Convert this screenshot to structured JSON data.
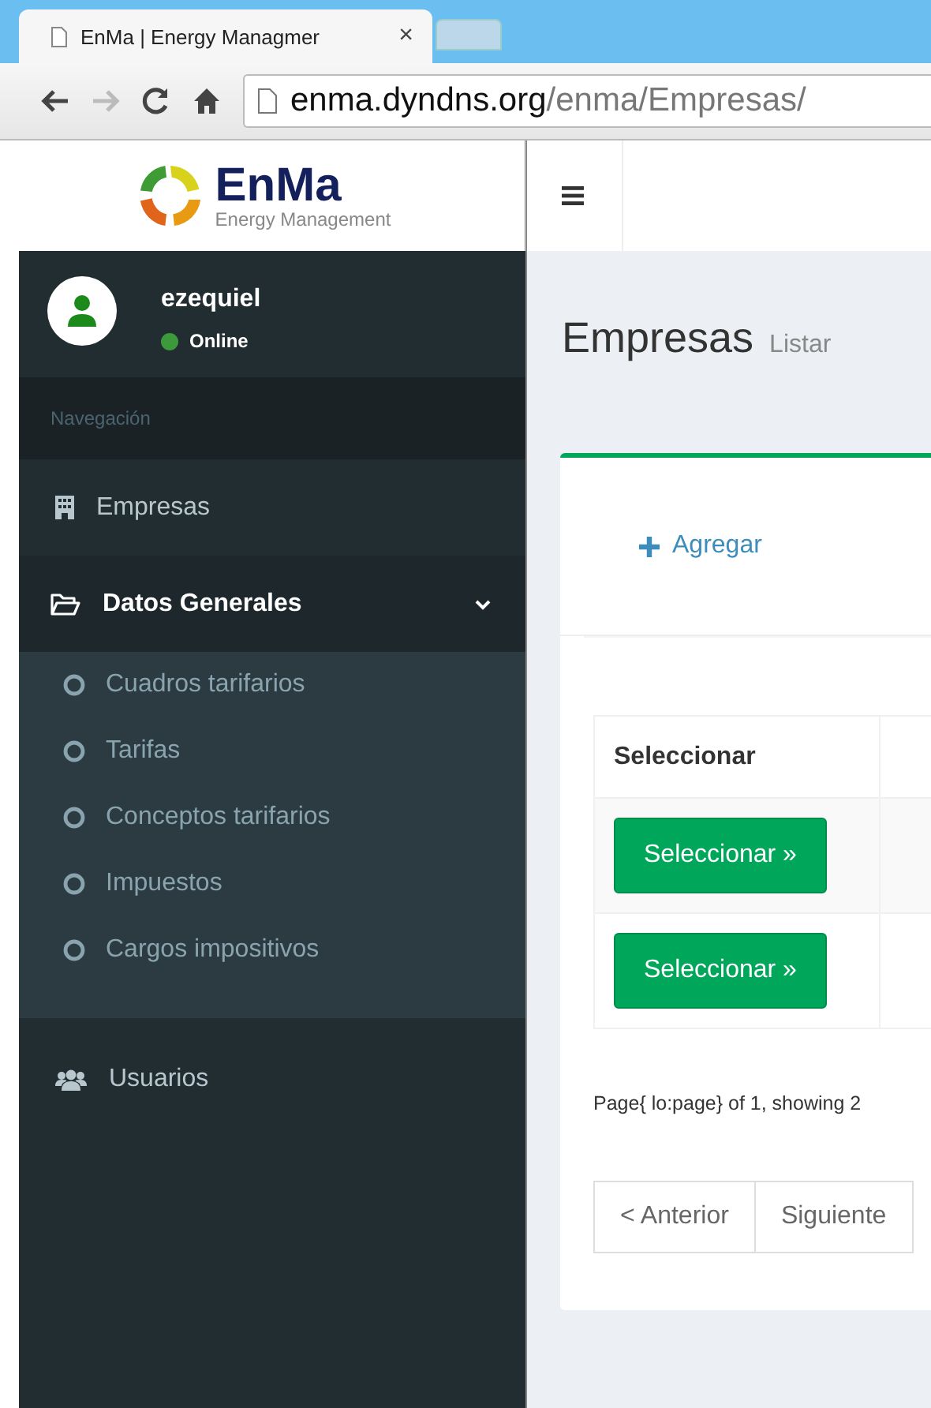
{
  "browser": {
    "tab_title": "EnMa | Energy Managmer",
    "tab_close": "×",
    "url_host": "enma.dyndns.org",
    "url_path": "/enma/Empresas/"
  },
  "logo": {
    "name": "EnMa",
    "tagline": "Energy Management"
  },
  "user": {
    "name": "ezequiel",
    "status": "Online"
  },
  "sidebar": {
    "header": "Navegación",
    "items": [
      {
        "label": "Empresas",
        "kind": "building",
        "selected": false
      },
      {
        "label": "Datos Generales",
        "kind": "folder",
        "selected": true,
        "expanded": true,
        "children": [
          {
            "label": "Cuadros tarifarios"
          },
          {
            "label": "Tarifas"
          },
          {
            "label": "Conceptos tarifarios"
          },
          {
            "label": "Impuestos"
          },
          {
            "label": "Cargos impositivos"
          }
        ]
      },
      {
        "label": "Usuarios",
        "kind": "users",
        "selected": false
      }
    ]
  },
  "page": {
    "title": "Empresas",
    "subtitle": "Listar"
  },
  "add_button": "Agregar",
  "table": {
    "columns": [
      "Seleccionar"
    ],
    "rows": [
      {
        "action": "Seleccionar »"
      },
      {
        "action": "Seleccionar »"
      }
    ]
  },
  "page_info": "Page{ lo:page} of 1, showing 2",
  "pagination": [
    "< Anterior",
    "Siguiente"
  ]
}
